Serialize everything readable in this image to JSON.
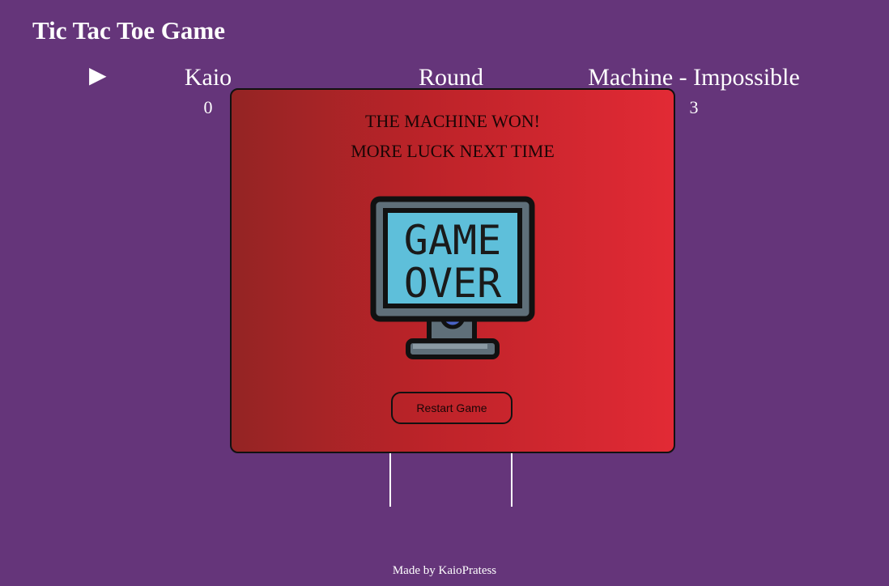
{
  "page": {
    "title": "Tic Tac Toe Game",
    "background_color": "#65357a"
  },
  "scoreboard": {
    "turn_indicator": "▶",
    "player_name": "Kaio",
    "player_score": "0",
    "round_label": "Round",
    "machine_name": "Machine - Impossible",
    "machine_score": "3"
  },
  "modal": {
    "message_line_1": "THE MACHINE WON!",
    "message_line_2": "MORE LUCK NEXT TIME",
    "image_text_line_1": "GAME",
    "image_text_line_2": "OVER",
    "image_icon": "game-over-monitor-icon",
    "restart_label": "Restart Game",
    "gradient_colors": [
      "#942424",
      "#e22a35"
    ]
  },
  "footer": {
    "credit": "Made by KaioPratess"
  }
}
